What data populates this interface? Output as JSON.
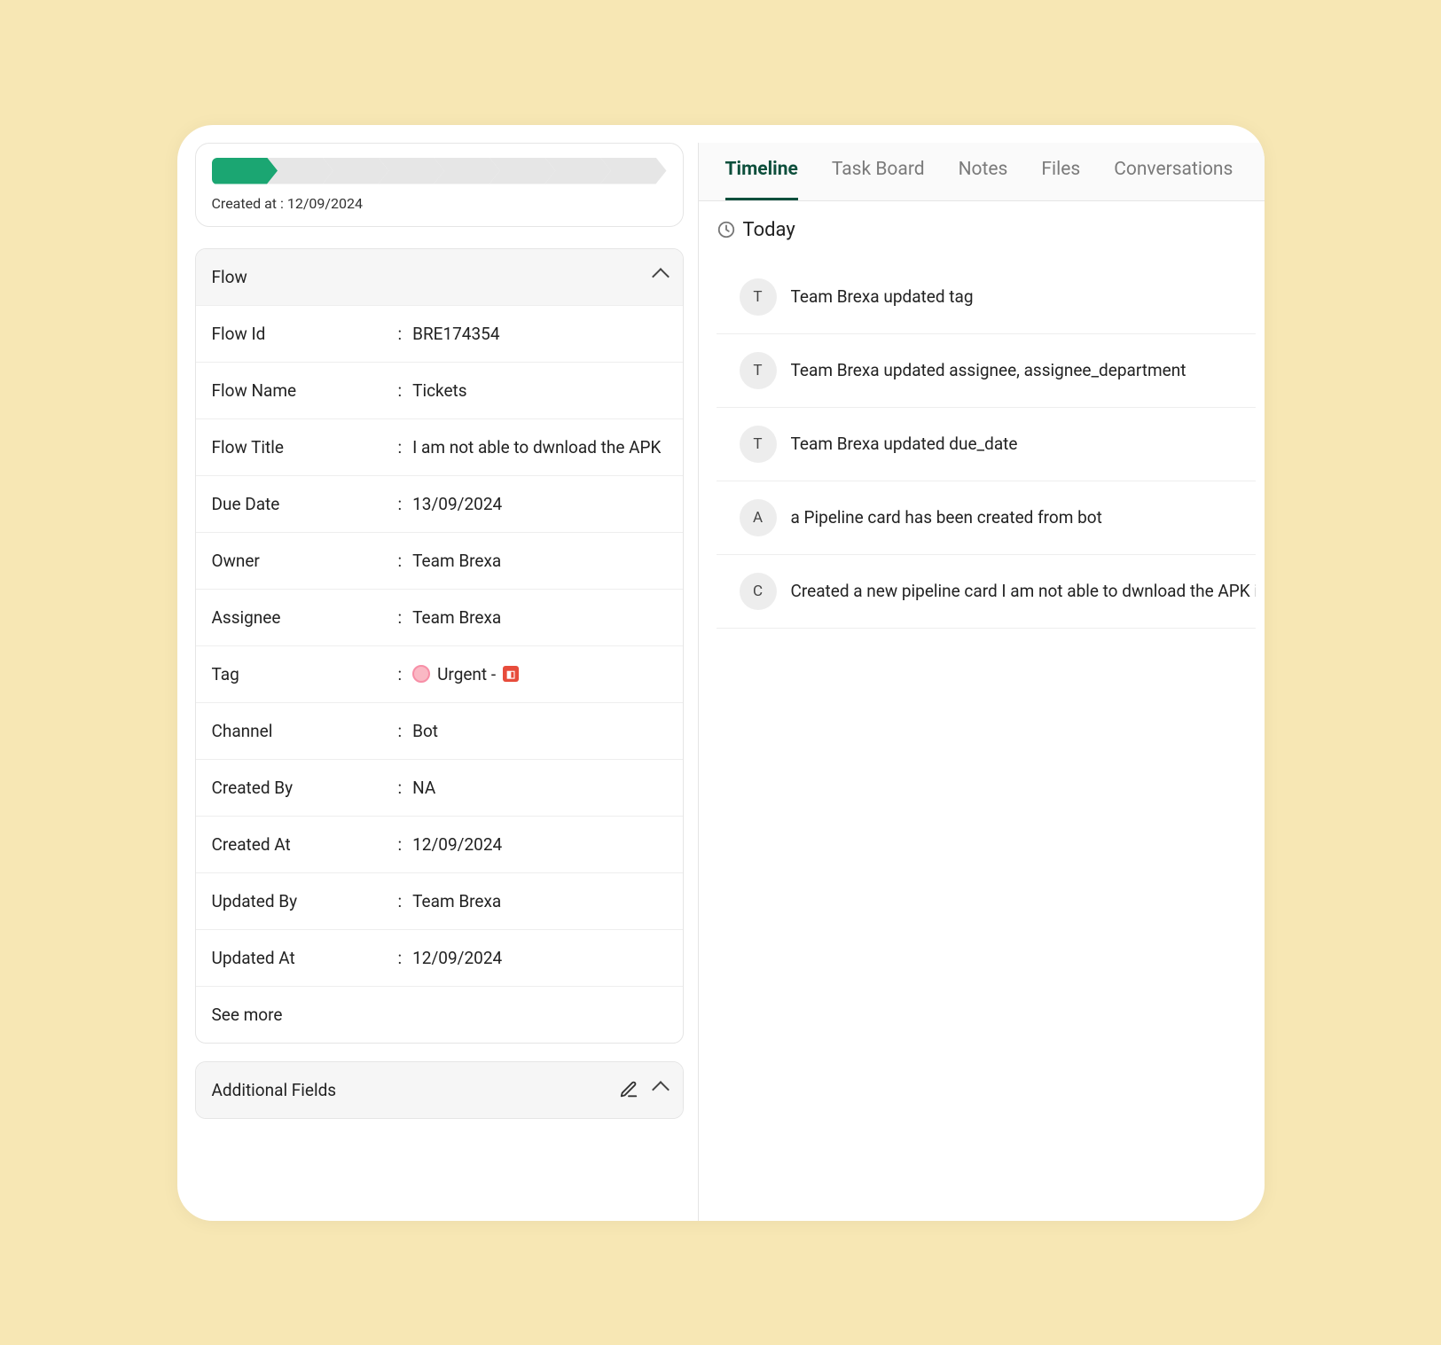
{
  "progress": {
    "created_at_label": "Created at : 12/09/2024",
    "total_steps": 8,
    "active_step": 1
  },
  "flow_section": {
    "title": "Flow",
    "see_more": "See more",
    "rows": [
      {
        "label": "Flow Id",
        "value": "BRE174354"
      },
      {
        "label": "Flow Name",
        "value": "Tickets"
      },
      {
        "label": "Flow Title",
        "value": "I am not able to dwnload the APK"
      },
      {
        "label": "Due Date",
        "value": "13/09/2024"
      },
      {
        "label": "Owner",
        "value": "Team Brexa"
      },
      {
        "label": "Assignee",
        "value": "Team Brexa"
      },
      {
        "label": "Tag",
        "value": "Urgent -",
        "is_tag": true
      },
      {
        "label": "Channel",
        "value": "Bot"
      },
      {
        "label": "Created By",
        "value": "NA"
      },
      {
        "label": "Created At",
        "value": "12/09/2024"
      },
      {
        "label": "Updated By",
        "value": "Team Brexa"
      },
      {
        "label": "Updated At",
        "value": "12/09/2024"
      }
    ]
  },
  "additional_section": {
    "title": "Additional Fields"
  },
  "tabs": [
    {
      "label": "Timeline",
      "active": true
    },
    {
      "label": "Task Board",
      "active": false
    },
    {
      "label": "Notes",
      "active": false
    },
    {
      "label": "Files",
      "active": false
    },
    {
      "label": "Conversations",
      "active": false
    }
  ],
  "timeline": {
    "today_label": "Today",
    "items": [
      {
        "avatar": "T",
        "text": "Team Brexa updated tag"
      },
      {
        "avatar": "T",
        "text": "Team Brexa updated assignee, assignee_department"
      },
      {
        "avatar": "T",
        "text": "Team Brexa updated due_date"
      },
      {
        "avatar": "A",
        "text": "a Pipeline card has been created from bot"
      },
      {
        "avatar": "C",
        "text": "Created a new pipeline card I am not able to dwnload the APK in"
      }
    ]
  }
}
